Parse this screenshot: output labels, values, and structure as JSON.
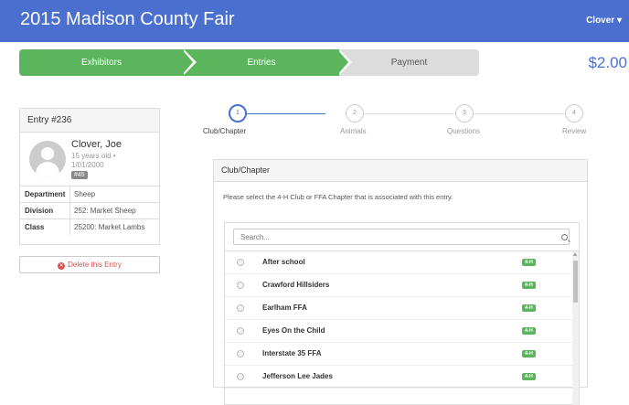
{
  "header": {
    "title": "2015 Madison County Fair",
    "user_menu": "Clover ▾"
  },
  "steps": [
    {
      "label": "Exhibitors",
      "state": "complete"
    },
    {
      "label": "Entries",
      "state": "complete"
    },
    {
      "label": "Payment",
      "state": "pending"
    }
  ],
  "total": "$2.00",
  "entry": {
    "title": "Entry #236",
    "name": "Clover, Joe",
    "age": "15 years old •",
    "dob": "1/01/2000",
    "badge": "#45",
    "rows": [
      {
        "key": "Department",
        "value": "Sheep"
      },
      {
        "key": "Division",
        "value": "252: Market Sheep"
      },
      {
        "key": "Class",
        "value": "25200: Market Lambs"
      }
    ],
    "delete_label": "Delete this Entry"
  },
  "wizard": [
    {
      "num": "1",
      "label": "Club/Chapter",
      "active": true
    },
    {
      "num": "2",
      "label": "Animals",
      "active": false
    },
    {
      "num": "3",
      "label": "Questions",
      "active": false
    },
    {
      "num": "4",
      "label": "Review",
      "active": false
    }
  ],
  "club": {
    "heading": "Club/Chapter",
    "help": "Please select the 4-H Club or FFA Chapter that is associated with this entry.",
    "search_placeholder": "Search...",
    "items": [
      {
        "name": "After school",
        "badge": "4-H"
      },
      {
        "name": "Crawford Hillsiders",
        "badge": "4-H"
      },
      {
        "name": "Earlham FFA",
        "badge": "4-H"
      },
      {
        "name": "Eyes On the Child",
        "badge": "4-H"
      },
      {
        "name": "Interstate 35 FFA",
        "badge": "4-H"
      },
      {
        "name": "Jefferson Lee Jades",
        "badge": "4-H"
      }
    ]
  },
  "colors": {
    "primary": "#4a6fcf",
    "success": "#5ab55c",
    "danger": "#d9534f"
  }
}
